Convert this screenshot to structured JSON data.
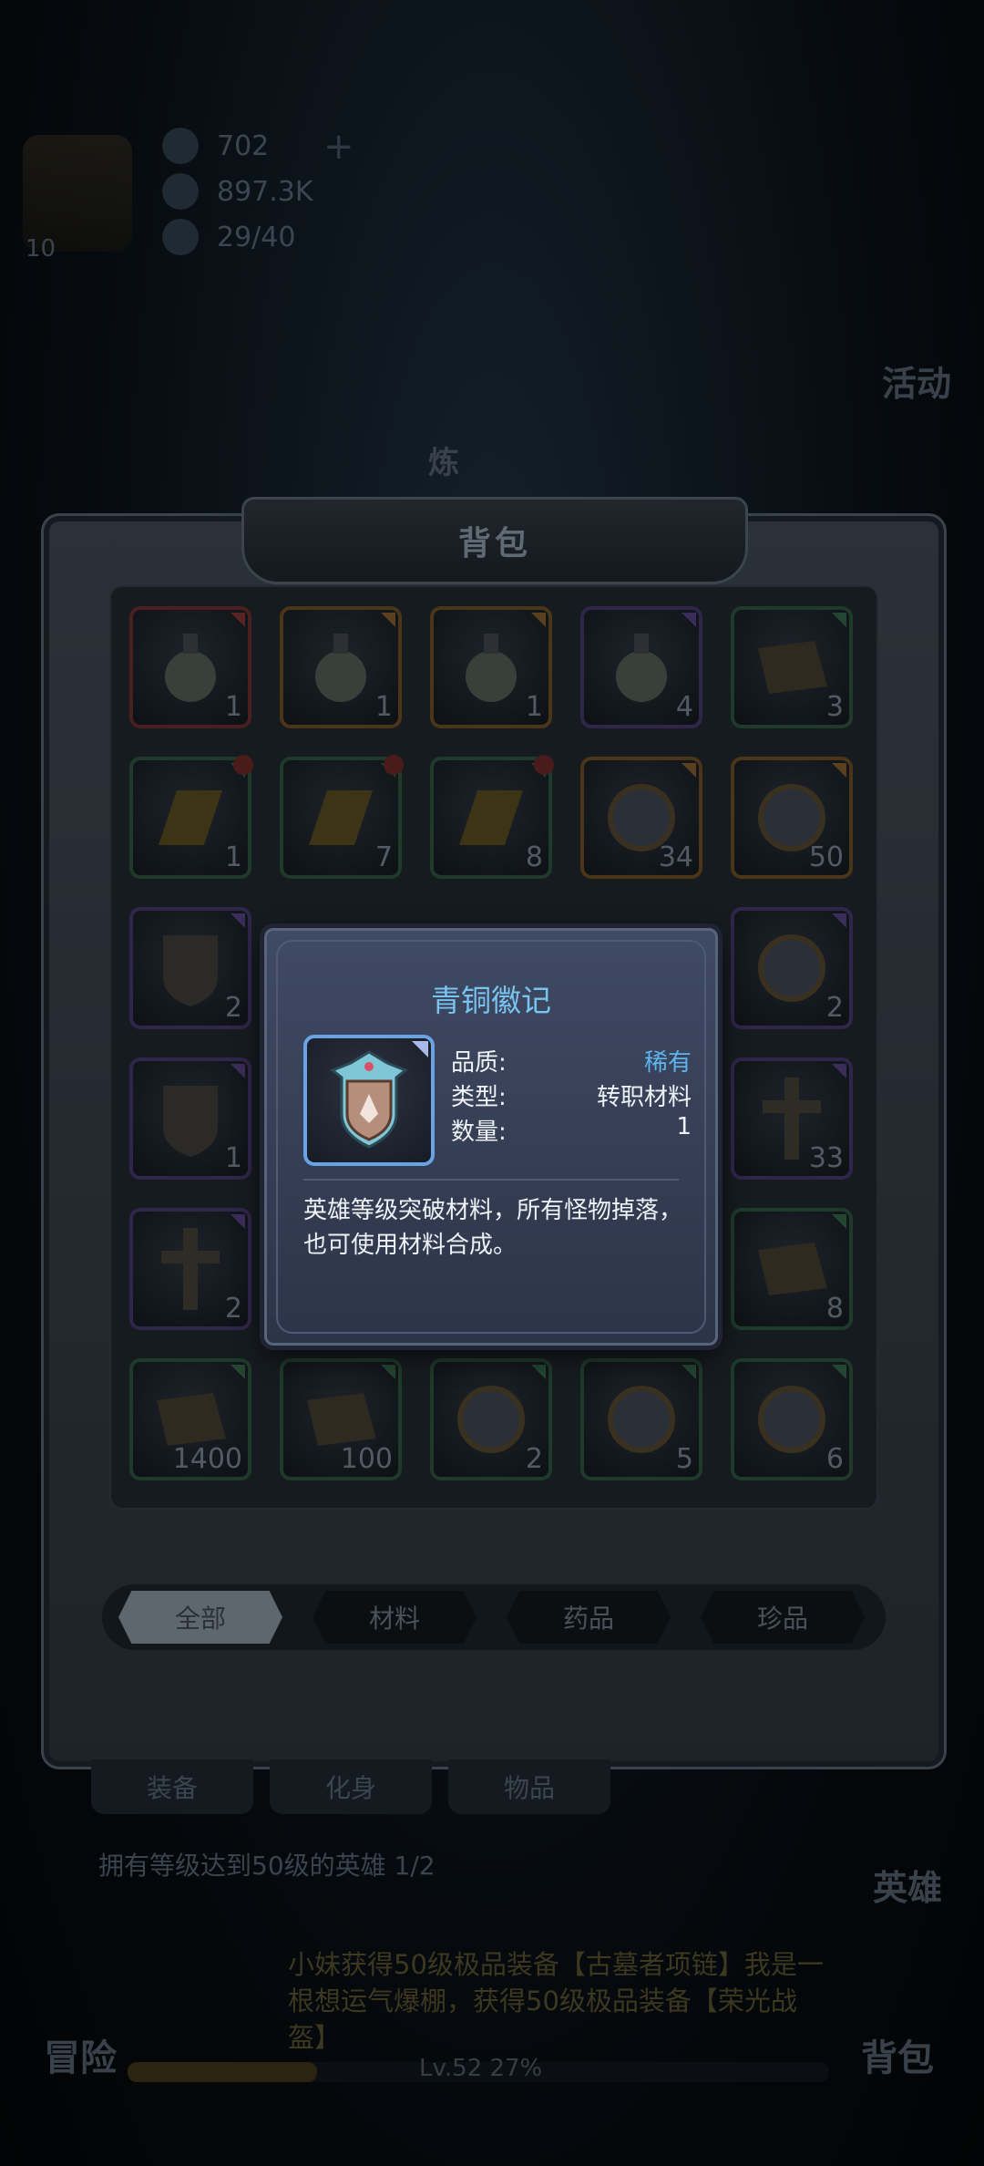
{
  "hud": {
    "diamonds": "702",
    "gold": "897.3K",
    "stamina": "29/40",
    "player_level": "10"
  },
  "side_labels": {
    "activity": "活动",
    "forge": "炼"
  },
  "backpack": {
    "title": "背包",
    "tabs": [
      {
        "label": "全部",
        "active": true
      },
      {
        "label": "材料",
        "active": false
      },
      {
        "label": "药品",
        "active": false
      },
      {
        "label": "珍品",
        "active": false
      }
    ],
    "items": [
      {
        "icon": "white-potion-icon",
        "count": "1",
        "rarity": "red"
      },
      {
        "icon": "blue-potion-icon",
        "count": "1",
        "rarity": "orange"
      },
      {
        "icon": "green-potion-jar-icon",
        "count": "1",
        "rarity": "orange"
      },
      {
        "icon": "green-potion-bottle-icon",
        "count": "4",
        "rarity": "purple"
      },
      {
        "icon": "scroll-icon",
        "count": "3",
        "rarity": "green"
      },
      {
        "icon": "gold-bar-large-icon",
        "count": "1",
        "rarity": "green",
        "dot": true
      },
      {
        "icon": "gold-bar-small-icon",
        "count": "7",
        "rarity": "green",
        "dot": true
      },
      {
        "icon": "gold-nugget-icon",
        "count": "8",
        "rarity": "green",
        "dot": true
      },
      {
        "icon": "purple-flower-icon",
        "count": "34",
        "rarity": "orange"
      },
      {
        "icon": "pink-gem-icon",
        "count": "50",
        "rarity": "orange"
      },
      {
        "icon": "gold-shield-badge-icon",
        "count": "2",
        "rarity": "purple"
      },
      {
        "icon": "crystal-box-icon",
        "count": "2",
        "rarity": "purple"
      },
      {
        "icon": "bronze-badge-icon",
        "count": "1",
        "rarity": "purple"
      },
      {
        "icon": "silver-cross-icon",
        "count": "33",
        "rarity": "purple"
      },
      {
        "icon": "bronze-cross-icon",
        "count": "2",
        "rarity": "purple"
      },
      {
        "icon": "sword-scroll-icon",
        "count": "8",
        "rarity": "green"
      },
      {
        "icon": "parchment-icon",
        "count": "1400",
        "rarity": "green"
      },
      {
        "icon": "parchment-icon",
        "count": "100",
        "rarity": "green"
      },
      {
        "icon": "red-rune-orb-icon",
        "count": "2",
        "rarity": "green"
      },
      {
        "icon": "purple-rune-orb-icon",
        "count": "5",
        "rarity": "green"
      },
      {
        "icon": "blue-rune-orb-icon",
        "count": "6",
        "rarity": "green"
      }
    ]
  },
  "popup": {
    "title": "青铜徽记",
    "icon": "bronze-badge-icon",
    "quality_label": "品质:",
    "quality_value": "稀有",
    "type_label": "类型:",
    "type_value": "转职材料",
    "quantity_label": "数量:",
    "quantity_value": "1",
    "description": "英雄等级突破材料，所有怪物掉落，也可使用材料合成。"
  },
  "bottom": {
    "tabs": [
      "装备",
      "化身",
      "物品"
    ],
    "hero_label": "英雄",
    "quest_text": "拥有等级达到50级的英雄 1/2",
    "marquee": "小妹获得50级极品装备【古墓者项链】我是一根想运气爆棚，获得50级极品装备【荣光战盔】",
    "adventure_label": "冒险",
    "backpack_label": "背包",
    "level_text": "Lv.52  27%",
    "level_progress": 0.27
  },
  "colors": {
    "rare_text": "#5fb4ee",
    "title_text": "#79c3f0",
    "rarity_red": "#4a1f1f",
    "rarity_orange": "#4a3518",
    "rarity_purple": "#30254a",
    "rarity_green": "#1f3a2a"
  }
}
